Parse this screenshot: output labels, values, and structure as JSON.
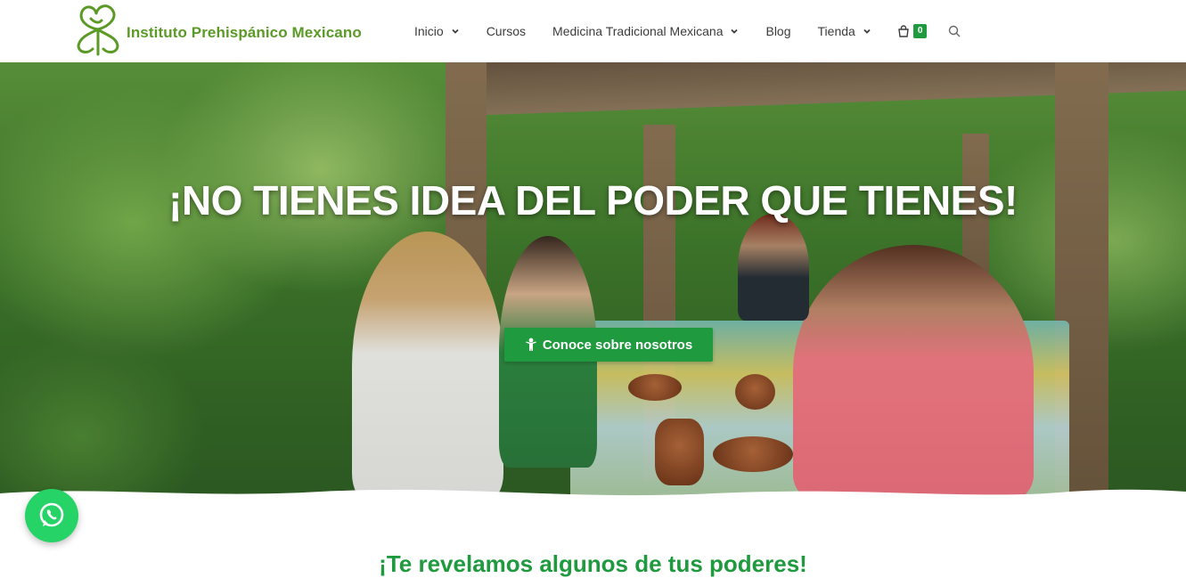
{
  "brand": {
    "name": "Instituto Prehispánico Mexicano",
    "logo_icon": "flower-leaf-logo-icon",
    "color": "#5b9a26"
  },
  "nav": {
    "items": [
      {
        "label": "Inicio",
        "has_dropdown": true
      },
      {
        "label": "Cursos",
        "has_dropdown": false
      },
      {
        "label": "Medicina Tradicional Mexicana",
        "has_dropdown": true
      },
      {
        "label": "Blog",
        "has_dropdown": false
      },
      {
        "label": "Tienda",
        "has_dropdown": true
      }
    ],
    "cart_count": "0",
    "cart_icon": "shopping-bag-icon",
    "search_icon": "search-icon"
  },
  "hero": {
    "title": "¡NO TIENES IDEA DEL PODER QUE TIENES!",
    "button_label": "Conoce sobre nosotros",
    "button_icon": "person-icon"
  },
  "section": {
    "heading": "¡Te revelamos algunos de tus poderes!"
  },
  "whatsapp": {
    "icon": "whatsapp-icon"
  },
  "colors": {
    "accent": "#1f9a3e",
    "logo_green": "#5b9a26",
    "whatsapp": "#25d366"
  }
}
